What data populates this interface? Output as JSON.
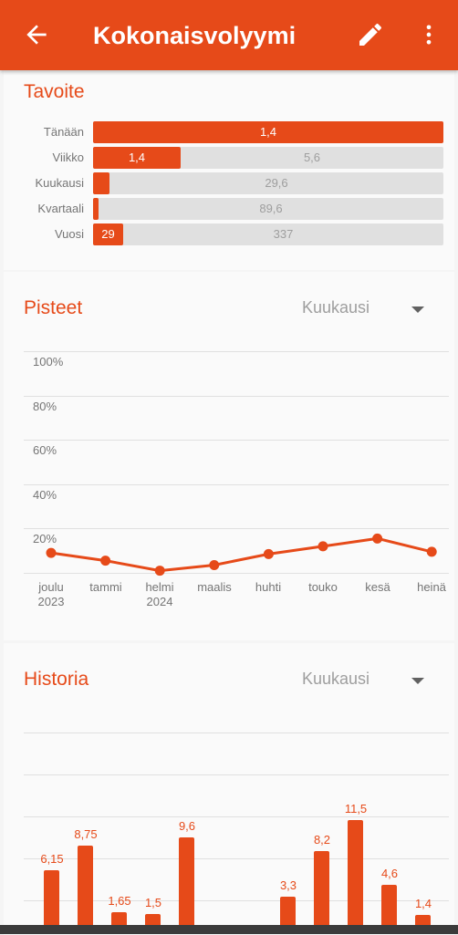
{
  "appbar": {
    "title": "Kokonaisvolyymi",
    "back_icon": "arrow-left-icon",
    "edit_icon": "pencil-icon",
    "menu_icon": "more-vertical-icon",
    "color": "#e64a19"
  },
  "goal": {
    "title": "Tavoite",
    "rows": [
      {
        "label": "Tänään",
        "value": "1,4",
        "total": "",
        "fraction": 1.0
      },
      {
        "label": "Viikko",
        "value": "1,4",
        "total": "5,6",
        "fraction": 0.25
      },
      {
        "label": "Kuukausi",
        "value": "",
        "total": "29,6",
        "fraction": 0.047
      },
      {
        "label": "Kvartaali",
        "value": "",
        "total": "89,6",
        "fraction": 0.016
      },
      {
        "label": "Vuosi",
        "value": "29",
        "total": "337",
        "fraction": 0.086
      }
    ]
  },
  "points": {
    "title": "Pisteet",
    "period": "Kuukausi",
    "chart_data": {
      "type": "line",
      "categories": [
        "joulu 2023",
        "tammi",
        "helmi 2024",
        "maalis",
        "huhti",
        "touko",
        "kesä",
        "heinä"
      ],
      "category_lines": [
        [
          "joulu",
          "2023"
        ],
        [
          "tammi",
          ""
        ],
        [
          "helmi",
          "2024"
        ],
        [
          "maalis",
          ""
        ],
        [
          "huhti",
          ""
        ],
        [
          "touko",
          ""
        ],
        [
          "kesä",
          ""
        ],
        [
          "heinä",
          ""
        ]
      ],
      "values": [
        9,
        5.5,
        1,
        3.5,
        8.5,
        12,
        15.5,
        9.5
      ],
      "yticks": [
        "20%",
        "40%",
        "60%",
        "80%",
        "100%"
      ],
      "ylim": [
        0,
        100
      ],
      "color": "#e64a19"
    }
  },
  "history": {
    "title": "Historia",
    "period": "Kuukausi",
    "chart_data": {
      "type": "bar",
      "values": [
        6.15,
        8.75,
        1.65,
        1.5,
        9.6,
        0,
        0,
        3.3,
        8.2,
        11.5,
        4.6,
        1.4
      ],
      "labels": [
        "6,15",
        "8,75",
        "1,65",
        "1,5",
        "9,6",
        "",
        "",
        "3,3",
        "8,2",
        "11,5",
        "4,6",
        "1,4"
      ],
      "color": "#e64a19"
    }
  }
}
